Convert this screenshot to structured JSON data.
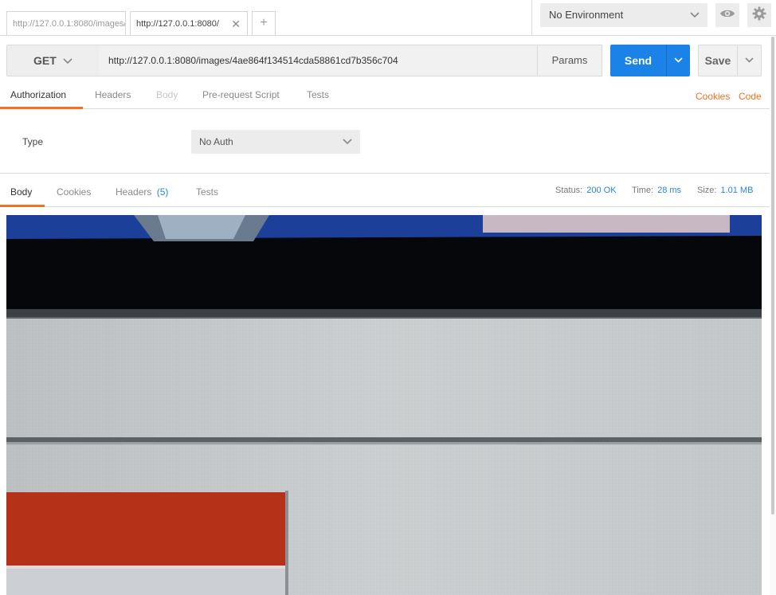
{
  "tabs": [
    {
      "title": "http://127.0.0.1:8080/images/4ae864f134514cda58861cd7b356c704",
      "active": false
    },
    {
      "title": "http://127.0.0.1:8080/",
      "active": true
    }
  ],
  "new_tab_label": "+",
  "environment": {
    "selected": "No Environment"
  },
  "icons": {
    "preview": "eye-icon",
    "settings": "gear-icon",
    "close": "close-icon",
    "dropdown": "chevron-down-icon"
  },
  "request": {
    "method": "GET",
    "url": "http://127.0.0.1:8080/images/4ae864f134514cda58861cd7b356c704",
    "params_label": "Params",
    "send_label": "Send",
    "save_label": "Save"
  },
  "request_tabs": [
    {
      "label": "Authorization",
      "state": "active"
    },
    {
      "label": "Headers",
      "state": "normal"
    },
    {
      "label": "Body",
      "state": "disabled"
    },
    {
      "label": "Pre-request Script",
      "state": "normal"
    },
    {
      "label": "Tests",
      "state": "normal"
    }
  ],
  "request_links": {
    "cookies": "Cookies",
    "code": "Code"
  },
  "auth": {
    "type_label": "Type",
    "type_value": "No Auth"
  },
  "response_tabs": [
    {
      "label": "Body",
      "state": "active"
    },
    {
      "label": "Cookies",
      "state": "normal"
    },
    {
      "label": "Headers",
      "count": "(5)",
      "state": "normal"
    },
    {
      "label": "Tests",
      "state": "normal"
    }
  ],
  "response_stats": {
    "status_label": "Status:",
    "status_value": "200 OK",
    "time_label": "Time:",
    "time_value": "28 ms",
    "size_label": "Size:",
    "size_value": "1.01 MB"
  },
  "colors": {
    "accent": "#f47023",
    "send": "#1b82e8",
    "stat_value": "#2a86d6"
  }
}
